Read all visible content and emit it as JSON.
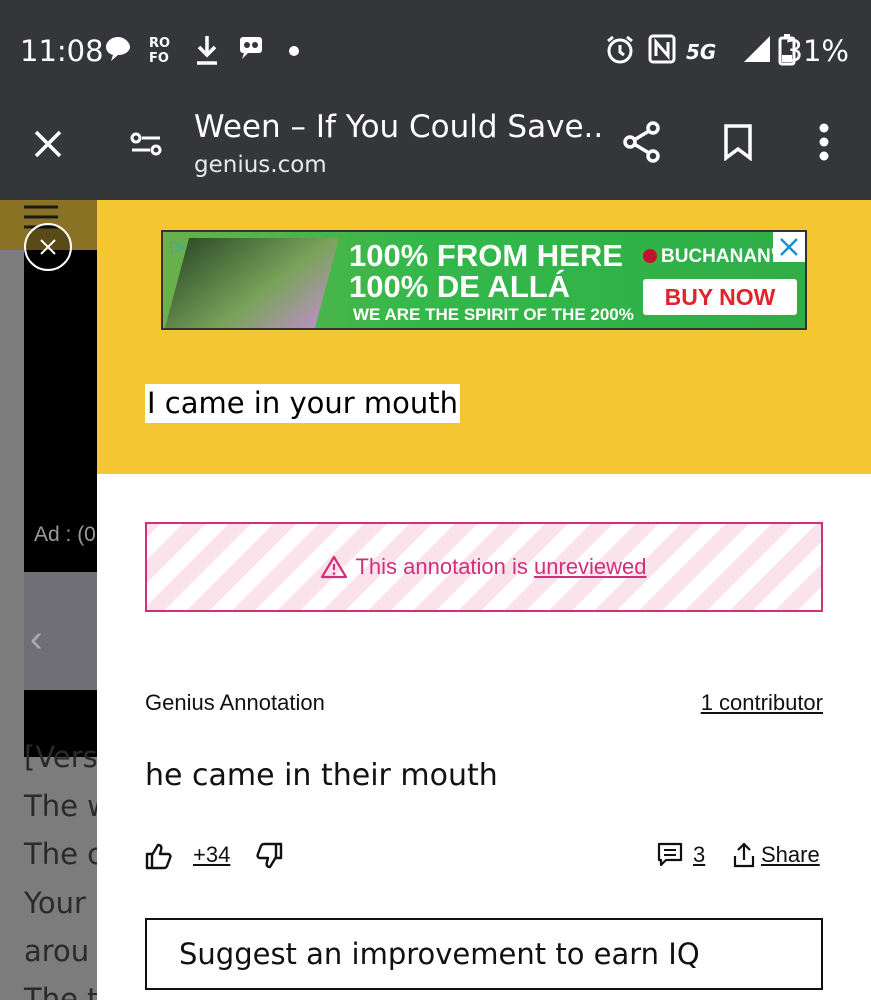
{
  "status_bar": {
    "time": "11:08",
    "network": "5G",
    "battery": "31%"
  },
  "toolbar": {
    "title": "Ween – If You Could Save...",
    "domain": "genius.com"
  },
  "background_page": {
    "ad_label": "Ad : (0",
    "lines": [
      "[Vers",
      "The w",
      "The c",
      "Your",
      "arou",
      "The t"
    ]
  },
  "ad": {
    "line1": "100% FROM HERE",
    "line2": "100% DE ALLÁ",
    "line3": "WE ARE THE SPIRIT OF THE 200%",
    "brand": "BUCHANAN'S",
    "cta": "BUY NOW"
  },
  "lyric": {
    "highlighted": "I came in your mouth"
  },
  "notice": {
    "text": "This annotation is ",
    "link": "unreviewed"
  },
  "annotation": {
    "label": "Genius Annotation",
    "contributors": "1 contributor",
    "body": "he came in their mouth",
    "votes": "+34",
    "comments": "3",
    "share": "Share"
  },
  "suggest": {
    "label": "Suggest an improvement to earn IQ"
  },
  "colors": {
    "chrome": "#35363a",
    "lyric_bg": "#f4c631",
    "notice": "#d22f7b"
  }
}
